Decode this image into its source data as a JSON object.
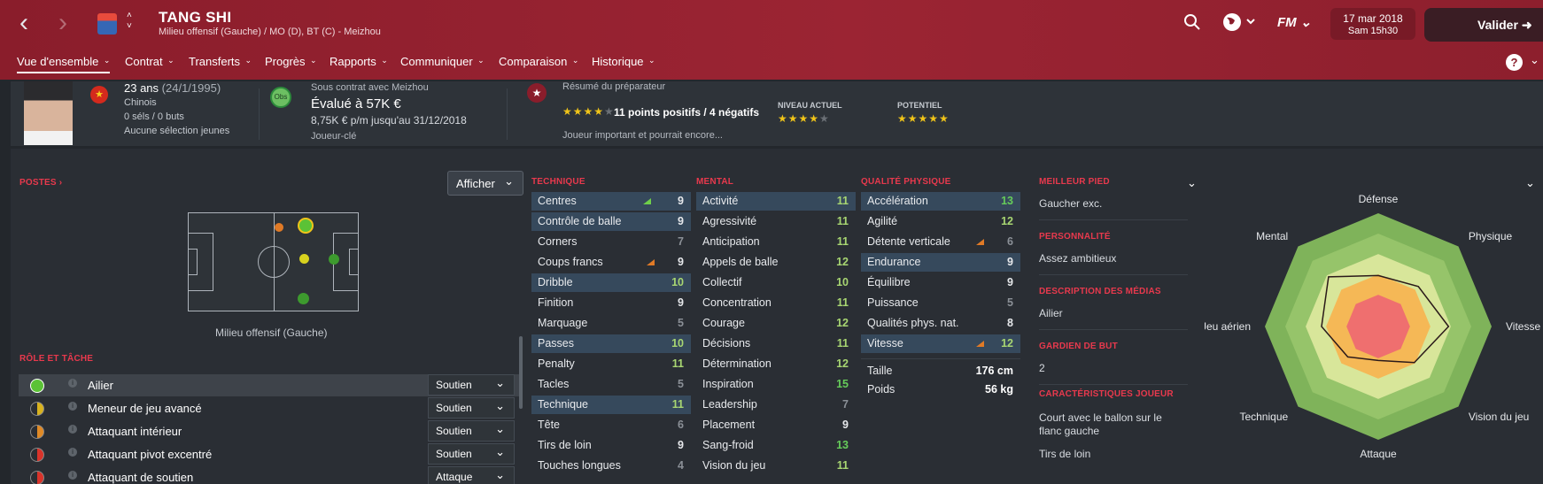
{
  "header": {
    "back_icon": "chevron-left-icon",
    "forward_icon": "chevron-right-icon",
    "player_name": "TANG SHI",
    "player_subtitle": "Milieu offensif (Gauche) / MO (D), BT (C) - Meizhou",
    "date": "17 mar 2018",
    "time": "Sam 15h30",
    "validate_label": "Valider",
    "search_icon": "search-icon",
    "world_icon": "globe-icon",
    "fm_label": "FM"
  },
  "tabs": [
    {
      "label": "Vue d'ensemble"
    },
    {
      "label": "Contrat"
    },
    {
      "label": "Transferts"
    },
    {
      "label": "Progrès"
    },
    {
      "label": "Rapports"
    },
    {
      "label": "Communiquer"
    },
    {
      "label": "Comparaison"
    },
    {
      "label": "Historique"
    }
  ],
  "summary": {
    "age": "23 ans",
    "birth": "(24/1/1995)",
    "nationality": "Chinois",
    "caps": "0 séls / 0 buts",
    "youth": "Aucune sélection jeunes",
    "contract_with": "Sous contrat avec Meizhou",
    "obs_label": "Obs",
    "value": "Évalué à 57K €",
    "wage": "8,75K € p/m jusqu'au 31/12/2018",
    "status": "Joueur-clé",
    "coach_title": "Résumé du préparateur",
    "coach_points": "11 points positifs / 4 négatifs",
    "coach_desc": "Joueur important et pourrait encore...",
    "current_label": "NIVEAU ACTUEL",
    "potential_label": "POTENTIEL",
    "coach_stars": 4,
    "current_stars": 4,
    "potential_stars": 5,
    "accent": "#9b2433"
  },
  "positions": {
    "title": "POSTES",
    "afficher": "Afficher",
    "pitch_label": "Milieu offensif (Gauche)"
  },
  "roles": {
    "title": "RÔLE ET TÂCHE",
    "items": [
      {
        "name": "Ailier",
        "duty": "Soutien"
      },
      {
        "name": "Meneur de jeu avancé",
        "duty": "Soutien"
      },
      {
        "name": "Attaquant intérieur",
        "duty": "Soutien"
      },
      {
        "name": "Attaquant pivot excentré",
        "duty": "Soutien"
      },
      {
        "name": "Attaquant de soutien",
        "duty": "Attaque"
      }
    ]
  },
  "technique": {
    "title": "TECHNIQUE",
    "items": [
      {
        "name": "Centres",
        "value": "9"
      },
      {
        "name": "Contrôle de balle",
        "value": "9"
      },
      {
        "name": "Corners",
        "value": "7"
      },
      {
        "name": "Coups francs",
        "value": "9"
      },
      {
        "name": "Dribble",
        "value": "10"
      },
      {
        "name": "Finition",
        "value": "9"
      },
      {
        "name": "Marquage",
        "value": "5"
      },
      {
        "name": "Passes",
        "value": "10"
      },
      {
        "name": "Penalty",
        "value": "11"
      },
      {
        "name": "Tacles",
        "value": "5"
      },
      {
        "name": "Technique",
        "value": "11"
      },
      {
        "name": "Tête",
        "value": "6"
      },
      {
        "name": "Tirs de loin",
        "value": "9"
      },
      {
        "name": "Touches longues",
        "value": "4"
      }
    ]
  },
  "mental": {
    "title": "MENTAL",
    "items": [
      {
        "name": "Activité",
        "value": "11"
      },
      {
        "name": "Agressivité",
        "value": "11"
      },
      {
        "name": "Anticipation",
        "value": "11"
      },
      {
        "name": "Appels de balle",
        "value": "12"
      },
      {
        "name": "Collectif",
        "value": "10"
      },
      {
        "name": "Concentration",
        "value": "11"
      },
      {
        "name": "Courage",
        "value": "12"
      },
      {
        "name": "Décisions",
        "value": "11"
      },
      {
        "name": "Détermination",
        "value": "12"
      },
      {
        "name": "Inspiration",
        "value": "15"
      },
      {
        "name": "Leadership",
        "value": "7"
      },
      {
        "name": "Placement",
        "value": "9"
      },
      {
        "name": "Sang-froid",
        "value": "13"
      },
      {
        "name": "Vision du jeu",
        "value": "11"
      }
    ]
  },
  "physique": {
    "title": "QUALITÉ PHYSIQUE",
    "items": [
      {
        "name": "Accélération",
        "value": "13"
      },
      {
        "name": "Agilité",
        "value": "12"
      },
      {
        "name": "Détente verticale",
        "value": "6"
      },
      {
        "name": "Endurance",
        "value": "9"
      },
      {
        "name": "Équilibre",
        "value": "9"
      },
      {
        "name": "Puissance",
        "value": "5"
      },
      {
        "name": "Qualités phys. nat.",
        "value": "8"
      },
      {
        "name": "Vitesse",
        "value": "12"
      }
    ],
    "height_label": "Taille",
    "height": "176 cm",
    "weight_label": "Poids",
    "weight": "56 kg"
  },
  "info": {
    "foot_title": "MEILLEUR PIED",
    "foot": "Gaucher exc.",
    "personality_title": "PERSONNALITÉ",
    "personality": "Assez ambitieux",
    "media_title": "DESCRIPTION DES MÉDIAS",
    "media": "Ailier",
    "gk_title": "GARDIEN DE BUT",
    "gk": "2",
    "traits_title": "CARACTÉRISTIQUES JOUEUR",
    "trait1": "Court avec le ballon sur le flanc gauche",
    "trait2": "Tirs de loin"
  },
  "radar": {
    "labels": [
      "Défense",
      "Physique",
      "Vitesse",
      "Vision du jeu",
      "Attaque",
      "Technique",
      "Jeu aérien",
      "Mental"
    ],
    "values": [
      0.45,
      0.5,
      0.62,
      0.45,
      0.3,
      0.38,
      0.5,
      0.62
    ]
  }
}
